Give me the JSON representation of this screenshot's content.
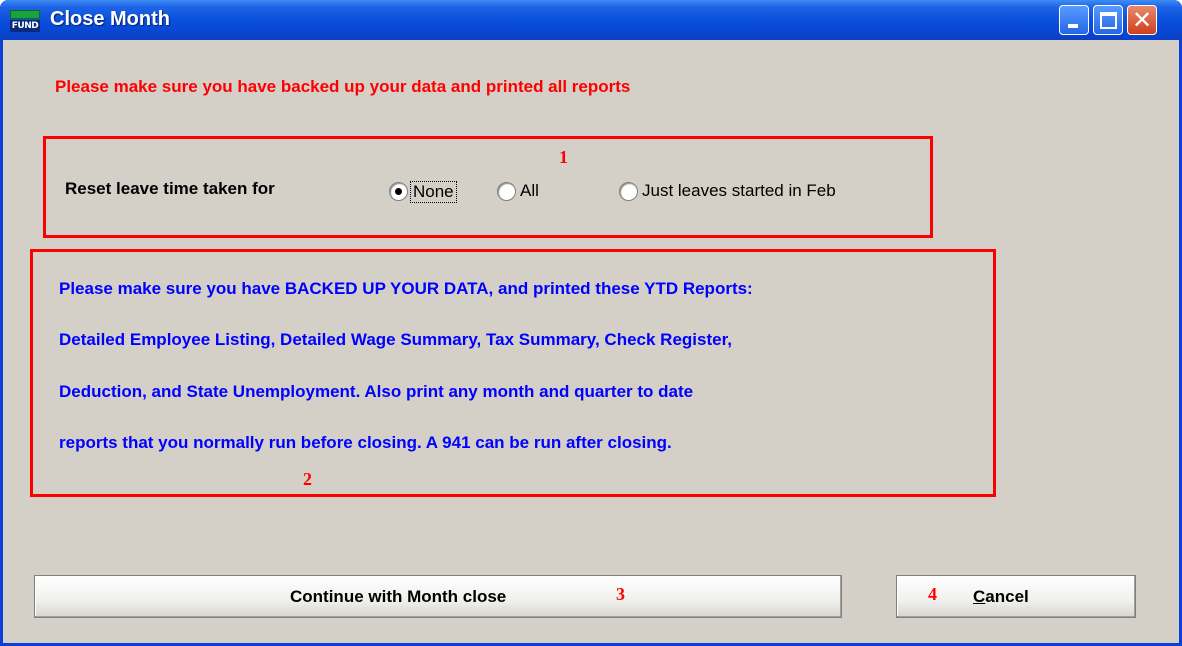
{
  "window": {
    "title": "Close Month",
    "logo_text": "FUND"
  },
  "warning": "Please make sure you have backed up your data and printed all reports",
  "leave_reset": {
    "callout": "1",
    "label": "Reset leave time taken for",
    "options": [
      {
        "label": "None",
        "selected": true
      },
      {
        "label": "All",
        "selected": false
      },
      {
        "label": "Just leaves started in Feb",
        "selected": false
      }
    ]
  },
  "notice": {
    "callout": "2",
    "lines": [
      "Please make sure you have BACKED UP YOUR DATA, and printed these YTD Reports:",
      "Detailed Employee Listing, Detailed Wage Summary, Tax Summary, Check Register,",
      "Deduction, and State Unemployment.  Also print any month and quarter to date",
      "reports that you normally run before closing.  A 941 can be run after closing."
    ]
  },
  "buttons": {
    "continue_label": "Continue with Month close",
    "continue_callout": "3",
    "cancel_label": "Cancel",
    "cancel_callout": "4"
  },
  "colors": {
    "titlebar": "#0a50dd",
    "client_bg": "#d4d0c8",
    "warning": "#ff0000",
    "notice_text": "#0000ff",
    "callout": "#ff0000"
  }
}
